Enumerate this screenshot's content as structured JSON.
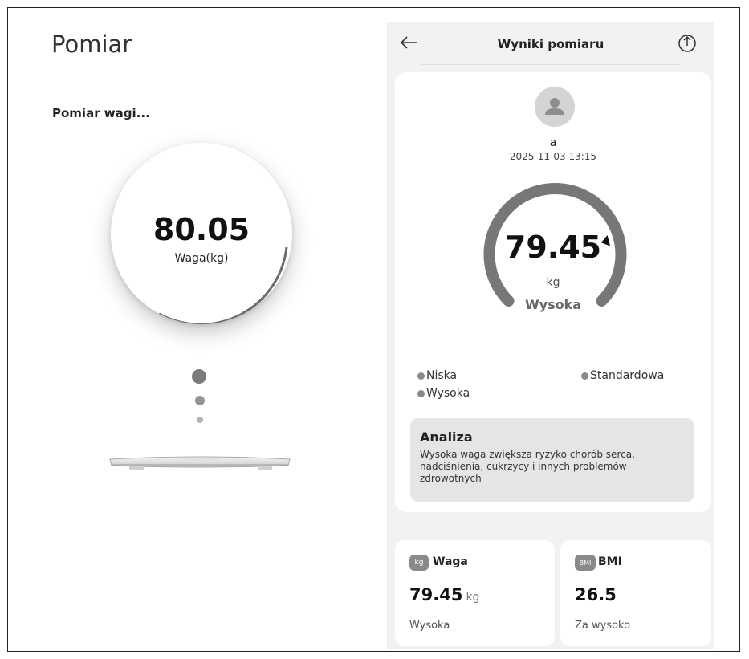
{
  "left": {
    "title": "Pomiar",
    "status": "Pomiar wagi...",
    "weight_value": "80.05",
    "weight_unit": "Waga(kg)"
  },
  "right": {
    "header": {
      "title": "Wyniki pomiaru",
      "back_icon": "arrow-left-icon",
      "share_icon": "share-upload-icon"
    },
    "profile": {
      "name": "a",
      "date": "2025-11-03 13:15"
    },
    "gauge": {
      "value": "79.45",
      "unit": "kg",
      "status": "Wysoka",
      "level_fraction": 0.78
    },
    "legend": [
      {
        "label": "Niska"
      },
      {
        "label": "Standardowa"
      },
      {
        "label": "Wysoka"
      }
    ],
    "analysis": {
      "title": "Analiza",
      "text": "Wysoka waga zwiększa ryzyko chorób serca, nadciśnienia, cukrzycy i innych problemów zdrowotnych"
    },
    "cards": [
      {
        "icon": "kg-weight-icon",
        "icon_text": "kg",
        "title": "Waga",
        "value": "79.45",
        "unit": "kg",
        "status": "Wysoka"
      },
      {
        "icon": "bmi-icon",
        "icon_text": "BMI",
        "title": "BMI",
        "value": "26.5",
        "unit": "",
        "status": "Za wysoko"
      }
    ]
  },
  "colors": {
    "gauge_track": "#777777",
    "panel_bg": "#f2f2f2",
    "card_bg": "#ffffff",
    "analysis_bg": "#e5e5e5"
  }
}
